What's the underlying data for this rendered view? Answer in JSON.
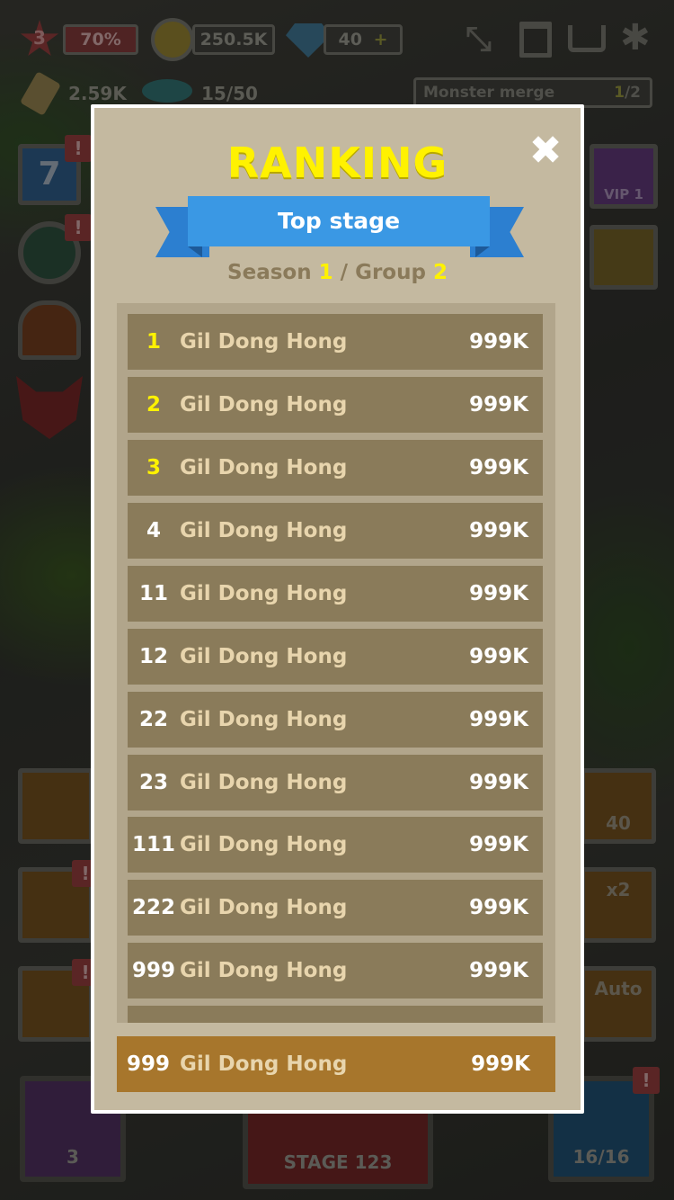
{
  "hud": {
    "level": "3",
    "progress": "70%",
    "gold": "250.5K",
    "gems": "40",
    "gem_plus": "+",
    "power": "2.59K",
    "capacity": "15/50",
    "quest_label": "Monster merge",
    "quest_done": "1",
    "quest_total": "/2"
  },
  "side": {
    "calendar_day": "7",
    "badge": "!",
    "vip_label": "VIP 1",
    "gem_reward": "40",
    "speed_label": "x2",
    "auto_label": "Auto"
  },
  "bottom": {
    "shard_count": "3",
    "stage_label": "STAGE 123",
    "monster_count": "16/16"
  },
  "modal": {
    "title": "RANKING",
    "close_symbol": "✖",
    "ribbon_label": "Top stage",
    "season_word": "Season",
    "season_num": "1",
    "separator": "/",
    "group_word": "Group",
    "group_num": "2"
  },
  "rows": [
    {
      "rank": "1",
      "name": "Gil Dong Hong",
      "score": "999K"
    },
    {
      "rank": "2",
      "name": "Gil Dong Hong",
      "score": "999K"
    },
    {
      "rank": "3",
      "name": "Gil Dong Hong",
      "score": "999K"
    },
    {
      "rank": "4",
      "name": "Gil Dong Hong",
      "score": "999K"
    },
    {
      "rank": "11",
      "name": "Gil Dong Hong",
      "score": "999K"
    },
    {
      "rank": "12",
      "name": "Gil Dong Hong",
      "score": "999K"
    },
    {
      "rank": "22",
      "name": "Gil Dong Hong",
      "score": "999K"
    },
    {
      "rank": "23",
      "name": "Gil Dong Hong",
      "score": "999K"
    },
    {
      "rank": "111",
      "name": "Gil Dong Hong",
      "score": "999K"
    },
    {
      "rank": "222",
      "name": "Gil Dong Hong",
      "score": "999K"
    },
    {
      "rank": "999",
      "name": "Gil Dong Hong",
      "score": "999K"
    }
  ],
  "my_row": {
    "rank": "999",
    "name": "Gil Dong Hong",
    "score": "999K"
  },
  "colors": {
    "title": "#fff200",
    "ribbon": "#3a98e4",
    "row": "#8a7b5a",
    "my_row": "#a7762c",
    "modal_bg": "#c4b9a0"
  }
}
